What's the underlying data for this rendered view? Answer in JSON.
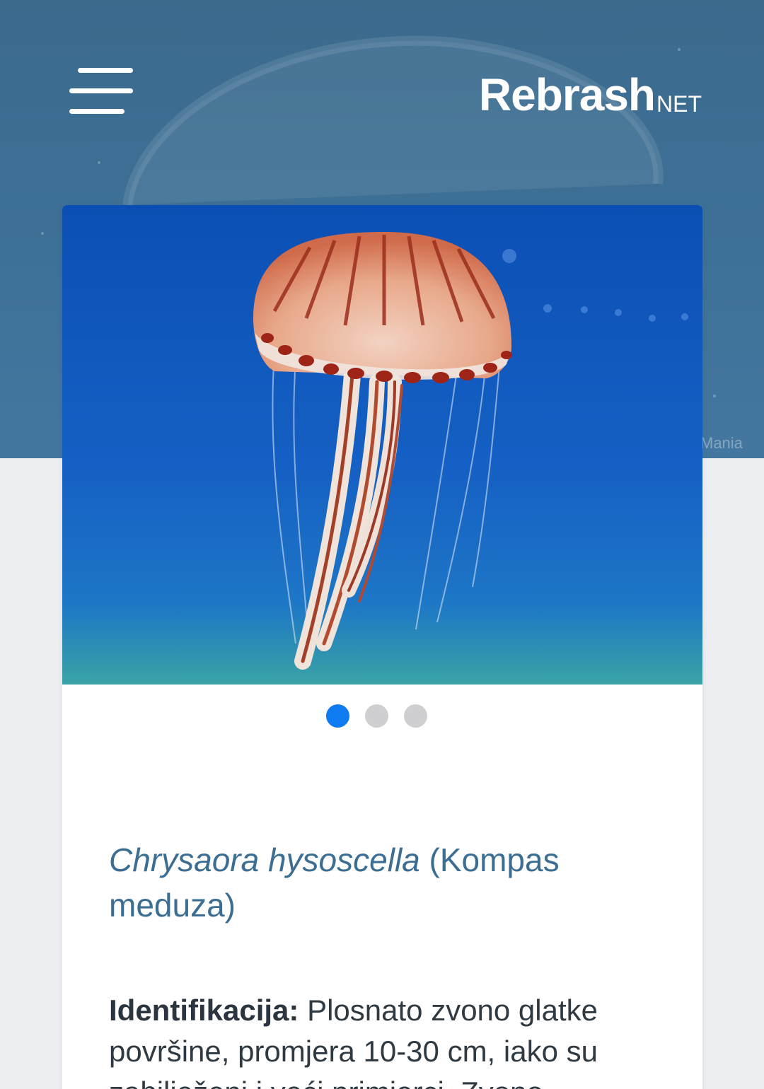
{
  "header": {
    "brand_main": "Rebrash",
    "brand_sub": "NET",
    "watermark": "Mania"
  },
  "gallery": {
    "image_alt": "Chrysaora hysoscella",
    "active_index": 0,
    "dot_count": 3
  },
  "species": {
    "latin_name": "Chrysaora hysoscella",
    "common_name": " (Kompas meduza)"
  },
  "description": {
    "label": "Identifikacija:",
    "text": " Plosnato zvono glatke površine, promjera 10-30 cm, iako su zabilježeni i veći primjerci. Zvono"
  },
  "colors": {
    "header_bg": "#3e7197",
    "title_color": "#3b6e92",
    "dot_active": "#0f7bf0",
    "dot_inactive": "#cfcfd1"
  }
}
